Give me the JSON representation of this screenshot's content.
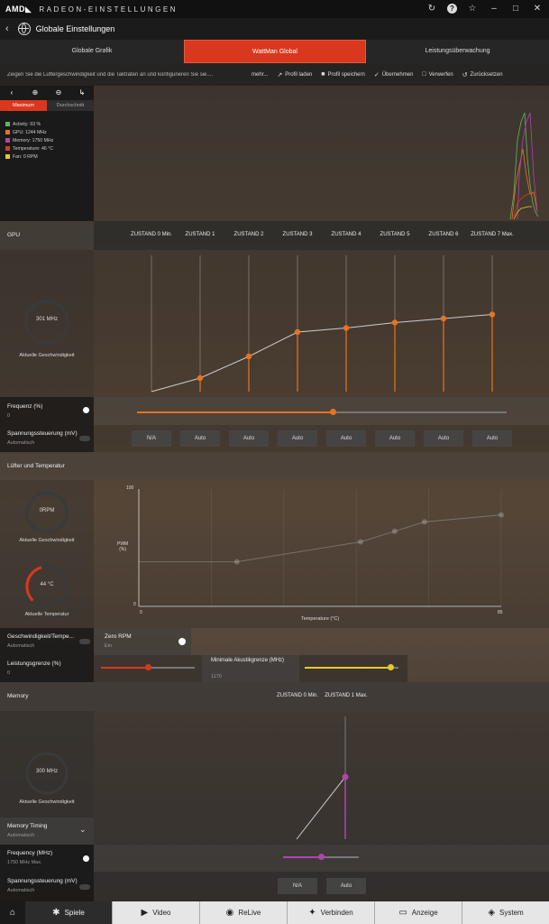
{
  "titlebar": {
    "logo": "AMD◣",
    "title": "RADEON-EINSTELLUNGEN",
    "icons": [
      "refresh-icon",
      "help-icon",
      "star-icon",
      "minimize-icon",
      "maximize-icon",
      "close-icon"
    ]
  },
  "header": {
    "back": "‹",
    "title": "Globale Einstellungen"
  },
  "tabs": [
    {
      "label": "Globale Grafik",
      "active": false
    },
    {
      "label": "WattMan Global",
      "active": true
    },
    {
      "label": "Leistungsüberwachung",
      "active": false
    }
  ],
  "toolbar": {
    "description": "Zeigen Sie die Lüftergeschwindigkeit und die Taktraten an und konfigurieren Sie sie....",
    "more": "mehr...",
    "buttons": [
      {
        "icon": "↗",
        "label": "Profil laden"
      },
      {
        "icon": "■",
        "label": "Profil speichern"
      },
      {
        "icon": "✓",
        "label": "Übernehmen"
      },
      {
        "icon": "□",
        "label": "Verwerfen"
      },
      {
        "icon": "↺",
        "label": "Zurücksetzen"
      }
    ]
  },
  "monitor": {
    "segments": [
      "Maximum",
      "Durchschnitt"
    ],
    "legend": [
      {
        "label": "Activity: 93 %",
        "color": "#5cb85c"
      },
      {
        "label": "GPU: 1244 MHz",
        "color": "#e8731e"
      },
      {
        "label": "Memory: 1750 MHz",
        "color": "#b044b0"
      },
      {
        "label": "Temperature: 46 °C",
        "color": "#d9381e"
      },
      {
        "label": "Fan: 0 RPM",
        "color": "#e8c82a"
      }
    ]
  },
  "gpu": {
    "section": "GPU",
    "states": [
      "ZUSTAND 0 Min.",
      "ZUSTAND 1",
      "ZUSTAND 2",
      "ZUSTAND 3",
      "ZUSTAND 4",
      "ZUSTAND 5",
      "ZUSTAND 6",
      "ZUSTAND 7 Max."
    ],
    "gauge_value": "301 MHz",
    "gauge_label": "Aktuelle Geschwindigkeit",
    "curve_levels": [
      0.0,
      0.1,
      0.26,
      0.44,
      0.47,
      0.51,
      0.54,
      0.57
    ],
    "freq_label": "Frequenz (%)",
    "freq_value": "0",
    "freq_slider": 0.53,
    "volt_label": "Spannungssteuerung (mV)",
    "volt_value": "Automatisch",
    "volt_cells": [
      "N/A",
      "Auto",
      "Auto",
      "Auto",
      "Auto",
      "Auto",
      "Auto",
      "Auto"
    ]
  },
  "fan": {
    "section": "Lüfter und Temperatur",
    "gauge_rpm": "0RPM",
    "gauge_rpm_label": "Aktuelle Geschwindigkeit",
    "gauge_temp": "44 °C",
    "gauge_temp_label": "Aktuelle Temperatur",
    "chart_ymax": "100",
    "chart_ymin": "0",
    "chart_xmin": "0",
    "chart_xmax": "85",
    "chart_ylabel": "PWM\n(%)",
    "chart_xlabel": "Temperature (°C)",
    "curve_points": [
      [
        0,
        38
      ],
      [
        23,
        38
      ],
      [
        52,
        55
      ],
      [
        60,
        64
      ],
      [
        67,
        72
      ],
      [
        85,
        78
      ]
    ],
    "speed_label": "Geschwindigkeit/Tempe...",
    "speed_value": "Automatisch",
    "zero_rpm_label": "Zero RPM",
    "zero_rpm_value": "Ein",
    "power_label": "Leistungsgrenze (%)",
    "power_value": "0",
    "power_slider": 0.5,
    "acoustic_label": "Minimale Akustikgrenze (MHz)",
    "acoustic_value": "1170",
    "acoustic_slider": 0.92
  },
  "memory": {
    "section": "Memory",
    "states": [
      "ZUSTAND 0 Min.",
      "ZUSTAND 1 Max."
    ],
    "gauge_value": "300 MHz",
    "gauge_label": "Aktuelle Geschwindigkeit",
    "timing_label": "Memory Timing",
    "timing_value": "Automatisch",
    "freq_label": "Frequency (MHz)",
    "freq_value": "1750 MHz Max.",
    "freq_slider": 0.5,
    "volt_label": "Spannungssteuerung (mV)",
    "volt_value": "Automatisch",
    "volt_cells": [
      "N/A",
      "Auto"
    ]
  },
  "bottomnav": [
    {
      "icon": "home-icon",
      "glyph": "⌂",
      "label": ""
    },
    {
      "icon": "gamepad-icon",
      "glyph": "✱",
      "label": "Spiele"
    },
    {
      "icon": "play-icon",
      "glyph": "▶",
      "label": "Video"
    },
    {
      "icon": "relive-icon",
      "glyph": "◉",
      "label": "ReLive"
    },
    {
      "icon": "connect-icon",
      "glyph": "✦",
      "label": "Verbinden"
    },
    {
      "icon": "display-icon",
      "glyph": "▭",
      "label": "Anzeige"
    },
    {
      "icon": "system-icon",
      "glyph": "◈",
      "label": "System"
    }
  ]
}
